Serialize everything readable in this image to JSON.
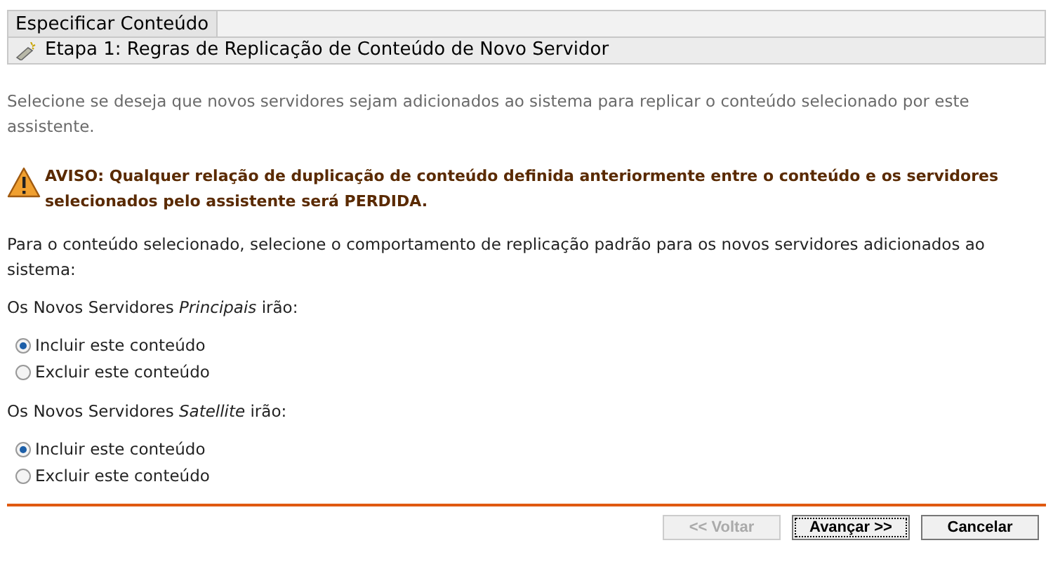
{
  "window": {
    "title": "Especificar Conteúdo"
  },
  "step": {
    "title": "Etapa 1: Regras de Replicação de Conteúdo de Novo Servidor"
  },
  "description": "Selecione se deseja que novos servidores sejam adicionados ao sistema para replicar o conteúdo selecionado por este assistente.",
  "warning": "AVISO: Qualquer relação de duplicação de conteúdo definida anteriormente entre o conteúdo e os servidores selecionados pelo assistente será PERDIDA.",
  "instruction": "Para o conteúdo selecionado, selecione o comportamento de replicação padrão para os novos servidores adicionados ao sistema:",
  "groups": [
    {
      "label": "Os Novos Servidores *Principais* irão:",
      "options": [
        {
          "label": "Incluir este conteúdo",
          "selected": true
        },
        {
          "label": "Excluir este conteúdo",
          "selected": false
        }
      ]
    },
    {
      "label": "Os Novos Servidores *Satellite* irão:",
      "options": [
        {
          "label": "Incluir este conteúdo",
          "selected": true
        },
        {
          "label": "Excluir este conteúdo",
          "selected": false
        }
      ]
    }
  ],
  "buttons": [
    {
      "label": "<< Voltar",
      "disabled": true,
      "focused": false
    },
    {
      "label": "Avançar >>",
      "disabled": false,
      "focused": true
    },
    {
      "label": "Cancelar",
      "disabled": false,
      "focused": false
    }
  ]
}
